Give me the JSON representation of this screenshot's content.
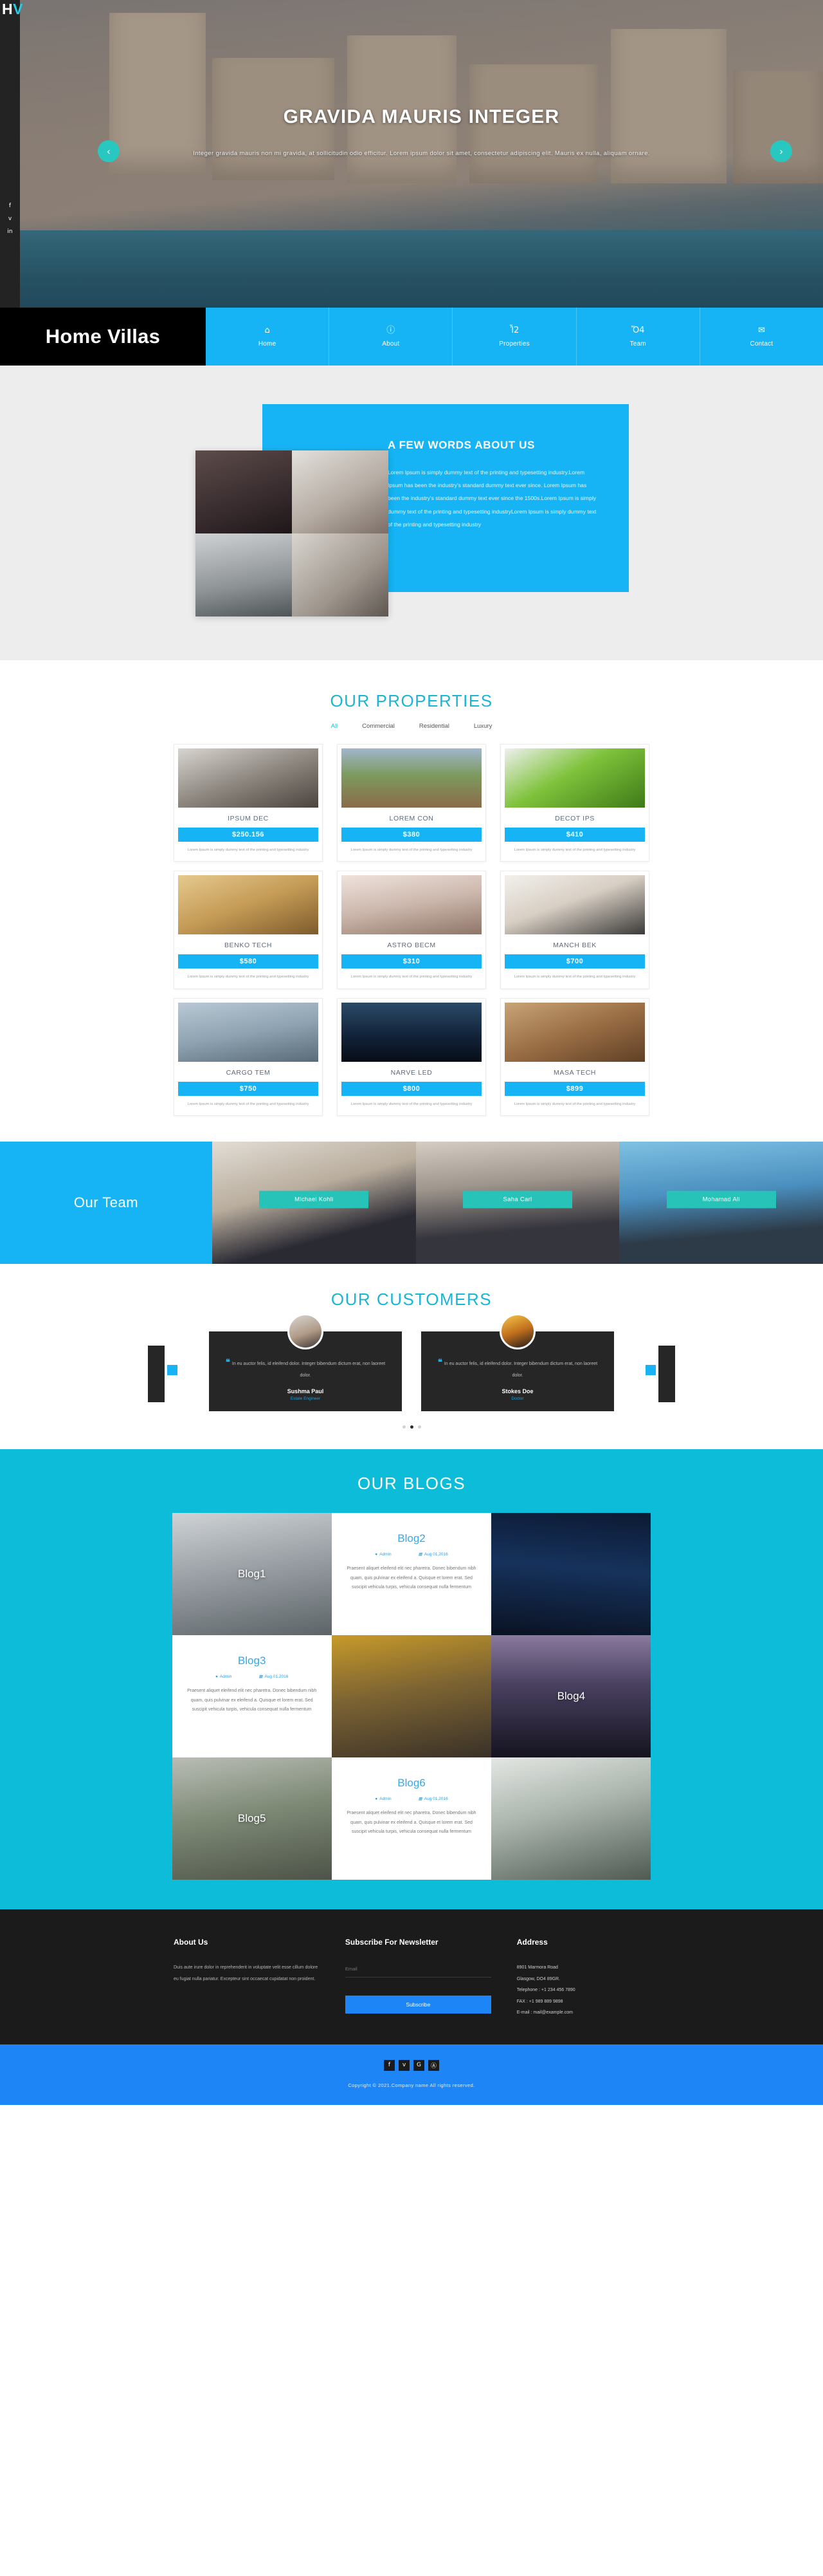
{
  "brand": {
    "mark_dark": "H",
    "mark_accent": "V",
    "name": "Home Villas"
  },
  "hero": {
    "title": "GRAVIDA MAURIS INTEGER",
    "subtitle": "Integer gravida mauris non mi gravida, at sollicitudin odio efficitur. Lorem ipsum dolor sit amet, consectetur adipiscing elit. Mauris ex nulla, aliquam ornare.",
    "prev_icon": "‹",
    "next_icon": "›",
    "social": [
      {
        "name": "facebook",
        "glyph": "f"
      },
      {
        "name": "twitter",
        "glyph": "ᴠ"
      },
      {
        "name": "linkedin",
        "glyph": "in"
      }
    ]
  },
  "nav": {
    "items": [
      {
        "label": "Home",
        "icon": "⌂"
      },
      {
        "label": "About",
        "icon": "ⓘ"
      },
      {
        "label": "Properties",
        "icon": "Ἶ2"
      },
      {
        "label": "Team",
        "icon": "Ὄ4"
      },
      {
        "label": "Contact",
        "icon": "✉"
      }
    ]
  },
  "about": {
    "heading": "A FEW WORDS ABOUT US",
    "body": "Lorem Ipsum is simply dummy text of the printing and typesetting industry.Lorem Ipsum has been the industry's standard dummy text ever since. Lorem Ipsum has been the industry's standard dummy text ever since the 1500s.Lorem Ipsum is simply dummy text of the printing and typesetting industryLorem Ipsum is simply dummy text of the printing and typesetting industry"
  },
  "properties": {
    "title": "OUR PROPERTIES",
    "filters": [
      {
        "label": "All",
        "active": true
      },
      {
        "label": "Commercial",
        "active": false
      },
      {
        "label": "Residential",
        "active": false
      },
      {
        "label": "Luxury",
        "active": false
      }
    ],
    "desc": "Lorem Ipsum is simply dummy text of the printing and typesetting industry",
    "items": [
      {
        "name": "IPSUM DEC",
        "price": "$250.156"
      },
      {
        "name": "LOREM CON",
        "price": "$380"
      },
      {
        "name": "DECOT IPS",
        "price": "$410"
      },
      {
        "name": "BENKO TECH",
        "price": "$580"
      },
      {
        "name": "ASTRO BECM",
        "price": "$310"
      },
      {
        "name": "MANCH BEK",
        "price": "$700"
      },
      {
        "name": "CARGO TEM",
        "price": "$750"
      },
      {
        "name": "NARVE LED",
        "price": "$800"
      },
      {
        "name": "MASA TECH",
        "price": "$899"
      }
    ]
  },
  "team": {
    "title": "Our Team",
    "members": [
      {
        "name": "Michael Kohli"
      },
      {
        "name": "Saha Carl"
      },
      {
        "name": "Mohamad Ali"
      }
    ]
  },
  "customers": {
    "title": "OUR CUSTOMERS",
    "quote_glyph": "❝",
    "testimonials": [
      {
        "text": "In eu auctor felis, id eleifend dolor. Integer bibendum dictum erat, non laoreet dolor.",
        "name": "Sushma Paul",
        "role": "Estate Engineer"
      },
      {
        "text": "In eu auctor felis, id eleifend dolor. Integer bibendum dictum erat, non laoreet dolor.",
        "name": "Stokes Doe",
        "role": "Doctor"
      }
    ],
    "dots": 3,
    "active_dot": 2
  },
  "blogs": {
    "title": "OUR BLOGS",
    "author": "Admin",
    "date": "Aug 01,2016",
    "author_icon": "●",
    "date_icon": "▦",
    "body": "Praesent aliquet eleifend elit nec pharetra. Donec bibendum nibh quam, quis pulvinar ex eleifend a. Quisque et lorem erat. Sed suscipit vehicula turpis, vehicula consequat nulla fermentum",
    "cards": [
      {
        "kind": "image",
        "caption": "Blog1"
      },
      {
        "kind": "text",
        "caption": "Blog2"
      },
      {
        "kind": "image",
        "caption": ""
      },
      {
        "kind": "text",
        "caption": "Blog3"
      },
      {
        "kind": "image",
        "caption": ""
      },
      {
        "kind": "image",
        "caption": "Blog4"
      },
      {
        "kind": "image",
        "caption": "Blog5"
      },
      {
        "kind": "text",
        "caption": "Blog6"
      },
      {
        "kind": "image",
        "caption": ""
      }
    ]
  },
  "footer": {
    "about": {
      "heading": "About Us",
      "body": "Duis aute irure dolor in reprehenderit in voluptate velit esse cillum dolore eu fugiat nulla pariatur. Excepteur sint occaecat cupidatat non proident."
    },
    "newsletter": {
      "heading": "Subscribe For Newsletter",
      "placeholder": "Email",
      "value": "",
      "button": "Subscribe"
    },
    "address": {
      "heading": "Address",
      "lines": [
        "8901 Marmora Road",
        "Glasgow, DO4 89GR.",
        "Telephone : +1 234 456 7890",
        "FAX : +1 989 889 9898",
        "E-mail : mail@example.com"
      ]
    },
    "social": [
      {
        "name": "facebook",
        "glyph": "f"
      },
      {
        "name": "twitter",
        "glyph": "ᴠ"
      },
      {
        "name": "google-plus",
        "glyph": "G"
      },
      {
        "name": "dribbble",
        "glyph": "Ⓐ"
      }
    ],
    "copyright": "Copyright © 2021.Company name All rights reserved."
  }
}
